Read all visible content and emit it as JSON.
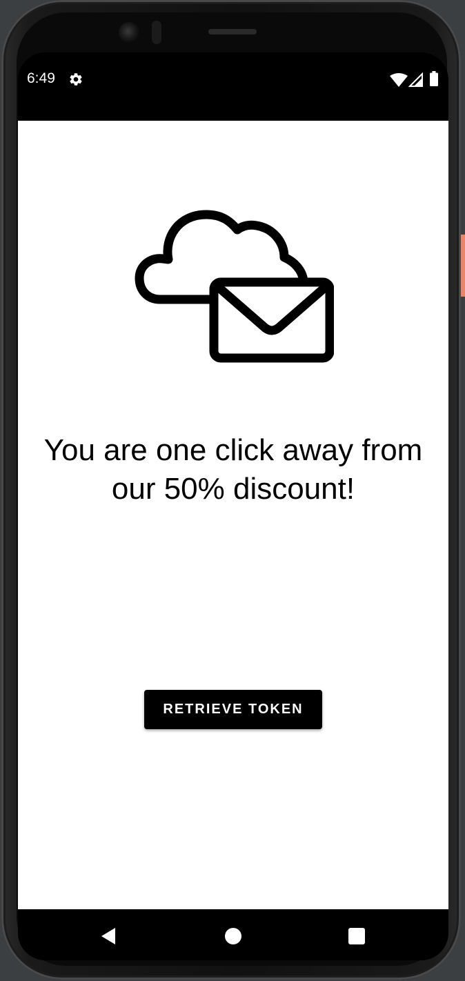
{
  "status_bar": {
    "time": "6:49",
    "icons": [
      "settings-icon",
      "wifi-icon",
      "signal-icon",
      "battery-icon"
    ]
  },
  "main": {
    "hero_icon": "cloud-mail-icon",
    "headline": "You are one click away from our 50% discount!",
    "button_label": "RETRIEVE TOKEN"
  },
  "nav_bar": {
    "icons": [
      "back-icon",
      "home-icon",
      "recents-icon"
    ]
  },
  "colors": {
    "screen_background": "#ffffff",
    "button_background": "#000000",
    "button_text": "#ffffff",
    "bars": "#000000"
  }
}
